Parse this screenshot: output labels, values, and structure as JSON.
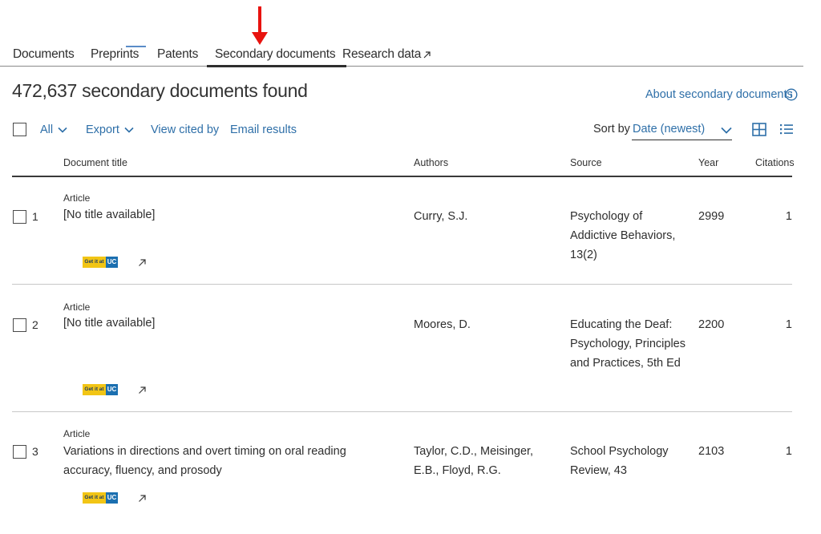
{
  "tabs": [
    {
      "label": "Documents"
    },
    {
      "label": "Preprints"
    },
    {
      "label": "Patents"
    },
    {
      "label": "Secondary documents",
      "active": true
    },
    {
      "label": "Research data"
    }
  ],
  "results": {
    "count_text": "472,637 secondary documents found",
    "about_link": "About secondary documents"
  },
  "toolbar": {
    "select_all": "All",
    "export": "Export",
    "view_cited_by": "View cited by",
    "email_results": "Email results",
    "sort_label": "Sort by",
    "sort_value": "Date (newest)"
  },
  "table": {
    "columns": [
      "Document title",
      "Authors",
      "Source",
      "Year",
      "Citations"
    ],
    "rows": [
      {
        "num": "1",
        "type": "Article",
        "title": "[No title available]",
        "authors": "Curry, S.J.",
        "source": "Psychology of Addictive Behaviors, 13(2)",
        "year": "2999",
        "citations": "1"
      },
      {
        "num": "2",
        "type": "Article",
        "title": "[No title available]",
        "authors": "Moores, D.",
        "source": "Educating the Deaf: Psychology, Principles and Practices, 5th Ed",
        "year": "2200",
        "citations": "1"
      },
      {
        "num": "3",
        "type": "Article",
        "title": "Variations in directions and overt timing on oral reading accuracy, fluency, and prosody",
        "authors": "Taylor, C.D., Meisinger, E.B., Floyd, R.G.",
        "source": "School Psychology Review, 43",
        "year": "2103",
        "citations": "1"
      }
    ]
  },
  "getit_badge": {
    "text_left": "Get it at",
    "text_right": "UC"
  },
  "colors": {
    "link": "#2e6fa8",
    "annotation_arrow": "#e8130f",
    "badge_yellow": "#f2c515",
    "badge_blue": "#1b6fb0"
  }
}
